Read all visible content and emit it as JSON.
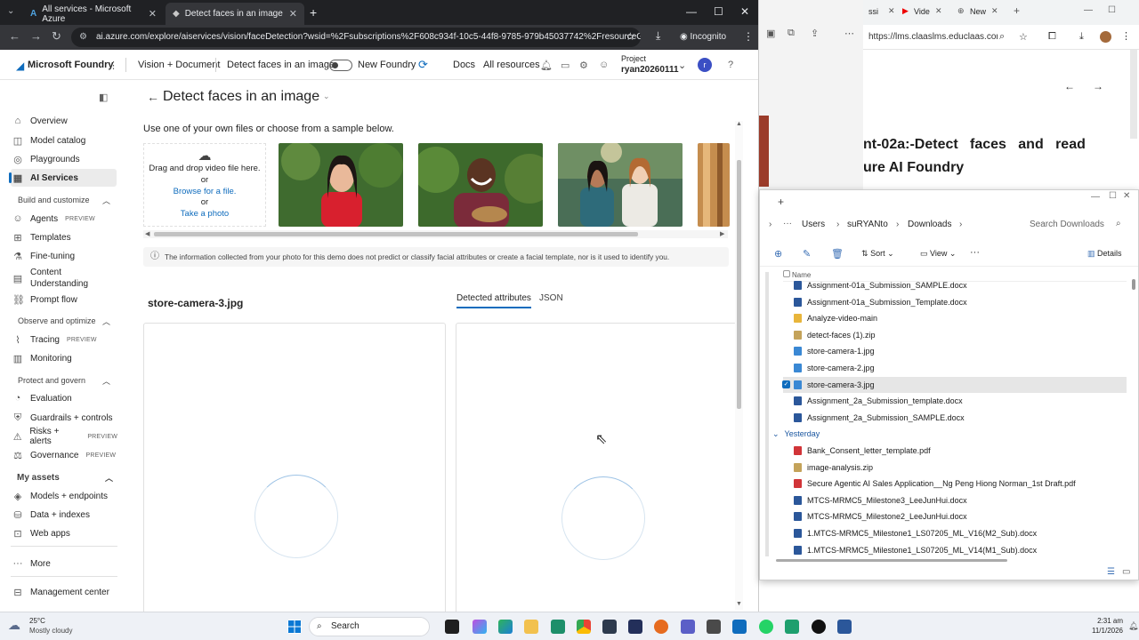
{
  "chrome": {
    "tabs": [
      {
        "label": "All services - Microsoft Azure"
      },
      {
        "label": "Detect faces in an image - Micr"
      }
    ],
    "url": "ai.azure.com/explore/aiservices/vision/faceDetection?wsid=%2Fsubscriptions%2F608c934f-10c5-44f8-9785-979b45037742%2FresourceGroup...",
    "incognito": "Incognito"
  },
  "header": {
    "brand": "Microsoft Foundry",
    "crumb1": "Vision + Document",
    "crumb2": "Detect faces in an image",
    "toggle": "New Foundry",
    "docs": "Docs",
    "resources": "All resources",
    "project_label": "Project",
    "project_name": "ryan20260111",
    "avatar": "r"
  },
  "nav": {
    "items": [
      {
        "label": "Overview",
        "icon": "home-icon"
      },
      {
        "label": "Model catalog",
        "icon": "cube-icon"
      },
      {
        "label": "Playgrounds",
        "icon": "playground-icon"
      },
      {
        "label": "AI Services",
        "icon": "ai-services-icon"
      }
    ],
    "sec_build": "Build and customize",
    "build": [
      {
        "label": "Agents",
        "badge": "PREVIEW"
      },
      {
        "label": "Templates"
      },
      {
        "label": "Fine-tuning"
      },
      {
        "label": "Content\nUnderstanding"
      },
      {
        "label": "Prompt flow"
      }
    ],
    "sec_observe": "Observe and optimize",
    "observe": [
      {
        "label": "Tracing",
        "badge": "PREVIEW"
      },
      {
        "label": "Monitoring"
      }
    ],
    "sec_protect": "Protect and govern",
    "protect": [
      {
        "label": "Evaluation"
      },
      {
        "label": "Guardrails + controls"
      },
      {
        "label": "Risks + alerts",
        "badge": "PREVIEW"
      },
      {
        "label": "Governance",
        "badge": "PREVIEW"
      }
    ],
    "sec_assets": "My assets",
    "assets": [
      {
        "label": "Models + endpoints"
      },
      {
        "label": "Data + indexes"
      },
      {
        "label": "Web apps"
      }
    ],
    "more": "More",
    "mgmt": "Management center"
  },
  "main": {
    "title": "Detect faces in an image",
    "instruction": "Use one of your own files or choose from a sample below.",
    "upload_drag": "Drag and drop video file here.",
    "upload_or1": "or",
    "upload_browse": "Browse for a file.",
    "upload_or2": "or",
    "upload_photo": "Take a photo",
    "notice": "The information collected from your photo for this demo does not predict or classify facial attributes or create a facial template, nor is it used to identify you.",
    "file_name": "store-camera-3.jpg",
    "tab_attrs": "Detected attributes",
    "tab_json": "JSON"
  },
  "rbrowser": {
    "tab1": "ssi",
    "tab2": "Vide",
    "tab3": "New",
    "url": "https://lms.claaslms.educlaas.com/learnin...",
    "heading1": "nt-02a:-Detect   faces   and   read",
    "heading2": "ure AI Foundry"
  },
  "explorer": {
    "crumbs": [
      "Users",
      "suRYANto",
      "Downloads"
    ],
    "search": "Search Downloads",
    "sort": "Sort",
    "view": "View",
    "details": "Details",
    "col_name": "Name",
    "files": [
      {
        "name": "Assignment-01a_Submission_SAMPLE.docx",
        "type": "docx"
      },
      {
        "name": "Assignment-01a_Submission_Template.docx",
        "type": "docx"
      },
      {
        "name": "Analyze-video-main",
        "type": "folder"
      },
      {
        "name": "detect-faces (1).zip",
        "type": "zip"
      },
      {
        "name": "store-camera-1.jpg",
        "type": "jpg"
      },
      {
        "name": "store-camera-2.jpg",
        "type": "jpg"
      },
      {
        "name": "store-camera-3.jpg",
        "type": "jpg",
        "selected": true
      },
      {
        "name": "Assignment_2a_Submission_template.docx",
        "type": "docx"
      },
      {
        "name": "Assignment_2a_Submission_SAMPLE.docx",
        "type": "docx"
      }
    ],
    "group_yesterday": "Yesterday",
    "files_y": [
      {
        "name": "Bank_Consent_letter_template.pdf",
        "type": "pdf"
      },
      {
        "name": "image-analysis.zip",
        "type": "zip"
      },
      {
        "name": "Secure Agentic AI Sales Application__Ng Peng Hiong Norman_1st Draft.pdf",
        "type": "pdf"
      },
      {
        "name": "MTCS-MRMC5_Milestone3_LeeJunHui.docx",
        "type": "docx"
      },
      {
        "name": "MTCS-MRMC5_Milestone2_LeeJunHui.docx",
        "type": "docx"
      },
      {
        "name": "1.MTCS-MRMC5_Milestone1_LS07205_ML_V16(M2_Sub).docx",
        "type": "docx"
      },
      {
        "name": "1.MTCS-MRMC5_Milestone1_LS07205_ML_V14(M1_Sub).docx",
        "type": "docx"
      }
    ]
  },
  "taskbar": {
    "temp": "25°C",
    "weather": "Mostly cloudy",
    "search": "Search",
    "time": "2:31 am",
    "date": "11/1/2026"
  },
  "colors": {
    "accent": "#0f6cbd",
    "docx": "#2b579a",
    "pdf": "#d13438",
    "folder": "#e8b53b",
    "zip": "#c4a35a",
    "jpg": "#3a88d4"
  }
}
